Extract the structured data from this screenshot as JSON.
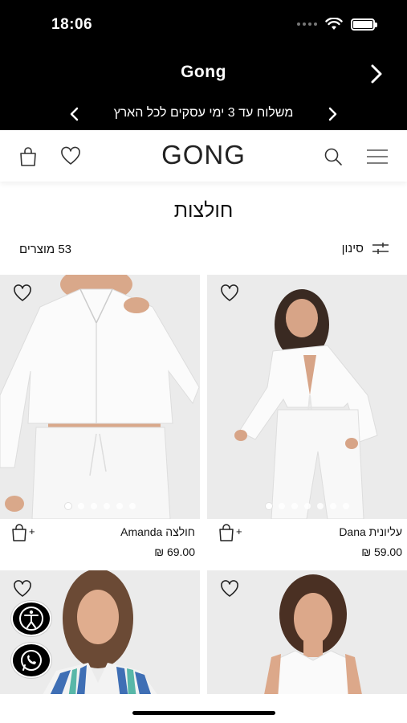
{
  "status_bar": {
    "time": "18:06"
  },
  "browser": {
    "title": "Gong"
  },
  "promo": {
    "text": "משלוח עד 3 ימי עסקים לכל הארץ"
  },
  "header": {
    "logo": "GONG"
  },
  "page": {
    "title": "חולצות",
    "count": "53 מוצרים",
    "filter_label": "סינון"
  },
  "products": [
    {
      "name": "חולצה Amanda",
      "price": "₪ 69.00",
      "cart_label": "+"
    },
    {
      "name": "עליונית Dana",
      "price": "₪ 59.00",
      "cart_label": "+"
    }
  ],
  "colors": {
    "accent": "#000000",
    "image_bg": "#ececec"
  }
}
